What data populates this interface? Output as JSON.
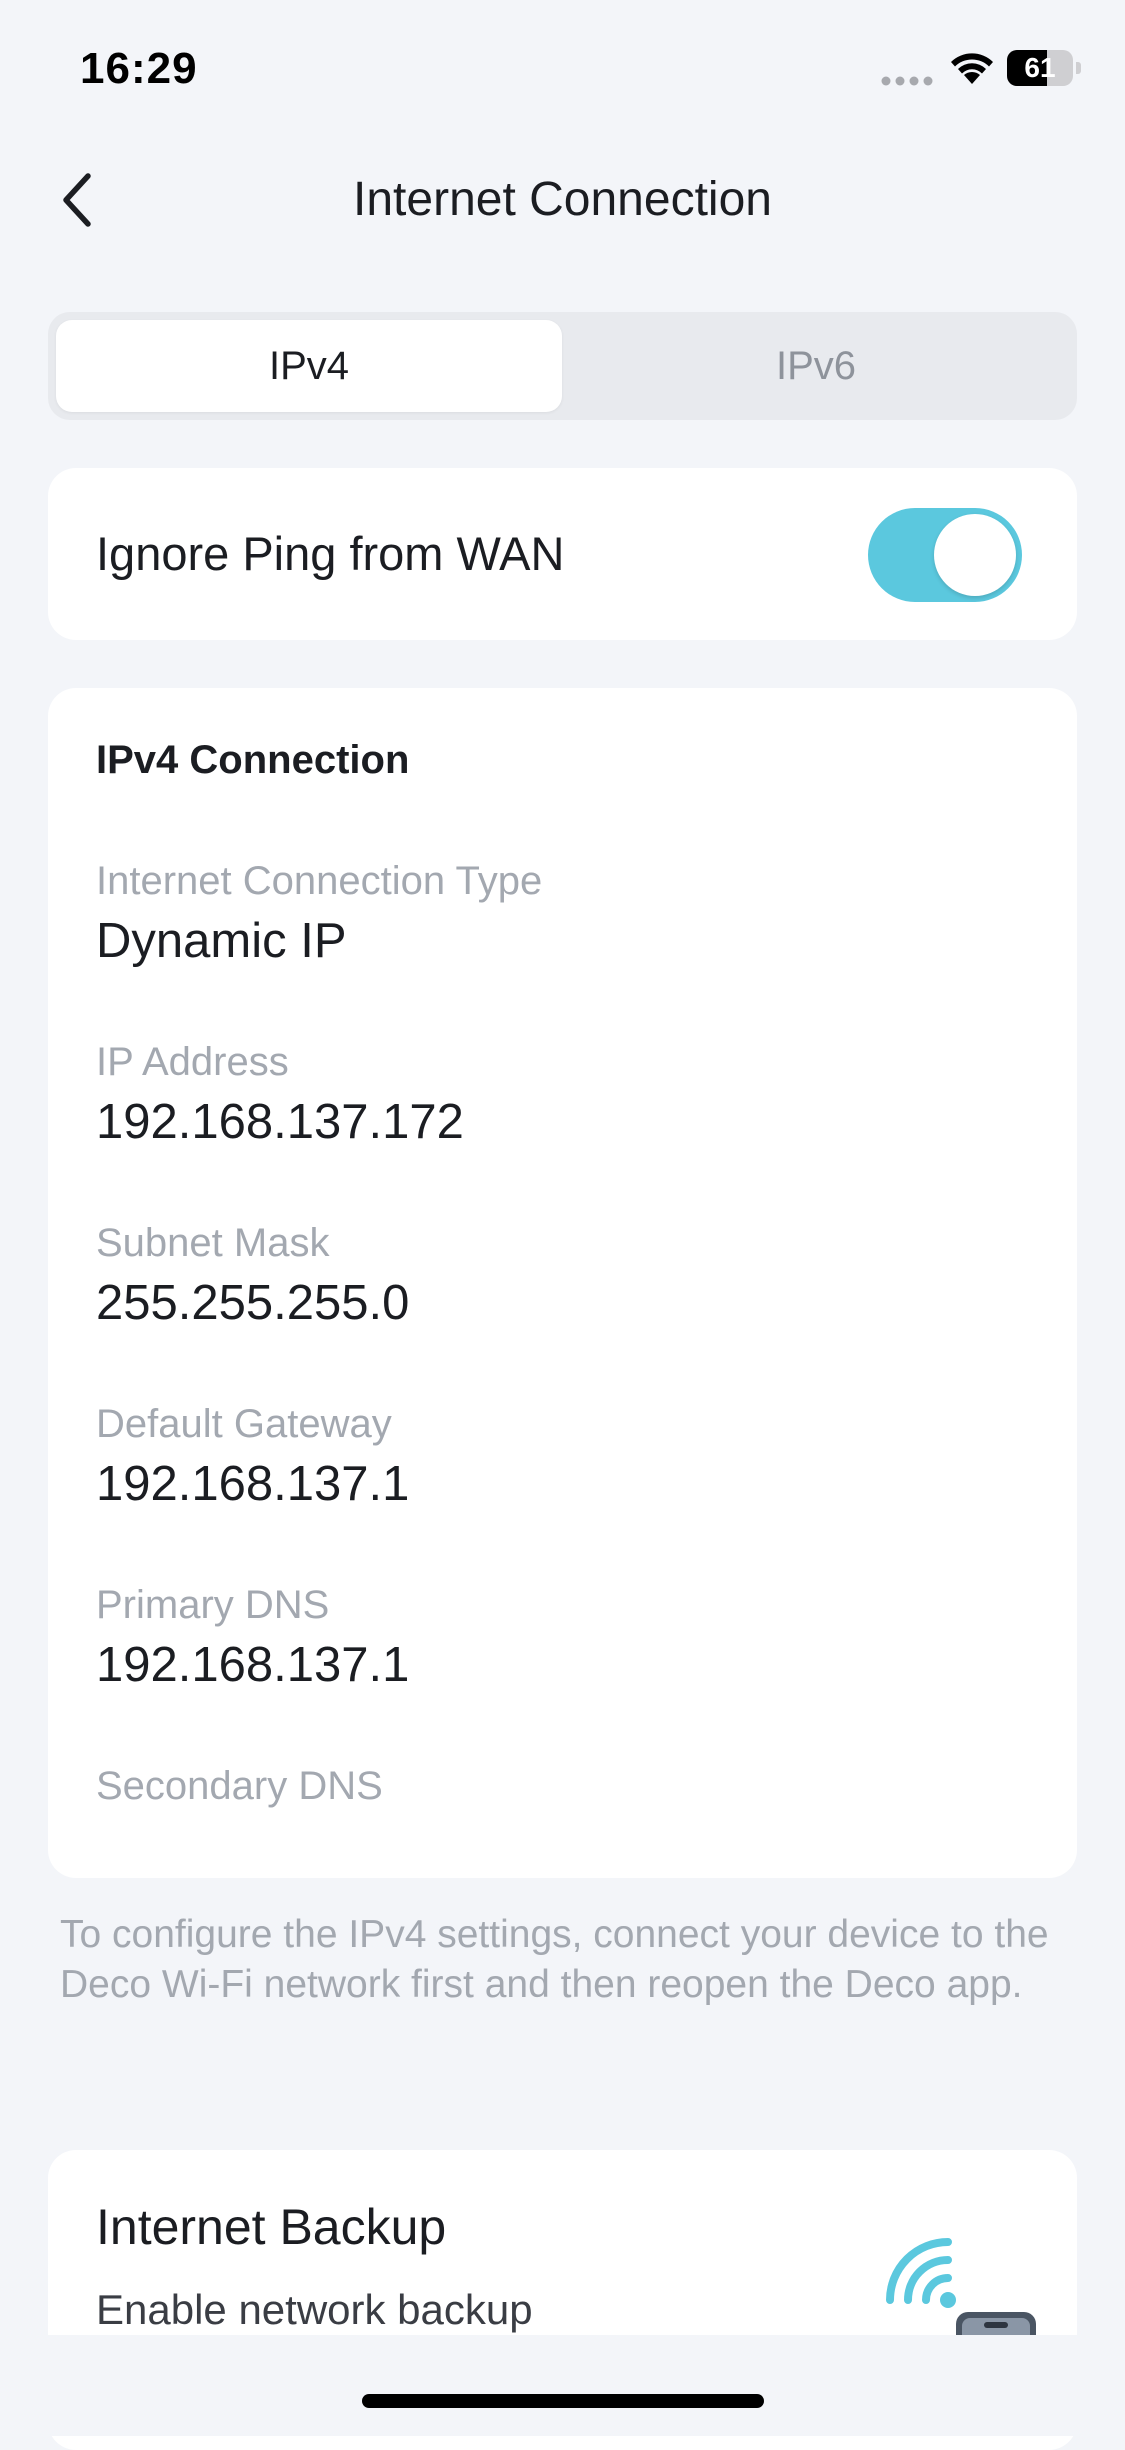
{
  "status_bar": {
    "time": "16:29",
    "battery_level": "61",
    "battery_fraction": 0.61,
    "icons": [
      "cellular-dots-icon",
      "wifi-icon",
      "battery-icon"
    ]
  },
  "nav": {
    "title": "Internet Connection",
    "back_icon": "chevron-left-icon"
  },
  "tabs": [
    {
      "label": "IPv4",
      "selected": true
    },
    {
      "label": "IPv6",
      "selected": false
    }
  ],
  "ping_setting": {
    "label": "Ignore Ping from WAN",
    "enabled": true
  },
  "ipv4_connection": {
    "heading": "IPv4 Connection",
    "fields": [
      {
        "label": "Internet Connection Type",
        "value": "Dynamic IP"
      },
      {
        "label": "IP Address",
        "value": "192.168.137.172"
      },
      {
        "label": "Subnet Mask",
        "value": "255.255.255.0"
      },
      {
        "label": "Default Gateway",
        "value": "192.168.137.1"
      },
      {
        "label": "Primary DNS",
        "value": "192.168.137.1"
      },
      {
        "label": "Secondary DNS",
        "value": ""
      }
    ]
  },
  "note": "To configure the IPv4 settings, connect your device to the Deco Wi-Fi network first and then reopen the Deco app.",
  "internet_backup": {
    "title": "Internet Backup",
    "subtitle": "Enable network backup",
    "illustration": "phone-wifi-illustration"
  },
  "colors": {
    "background": "#F3F5F9",
    "card": "#FFFFFF",
    "accent": "#5BC8DE",
    "label_gray": "#A3A8B0",
    "text_dark": "#1B1D22"
  }
}
